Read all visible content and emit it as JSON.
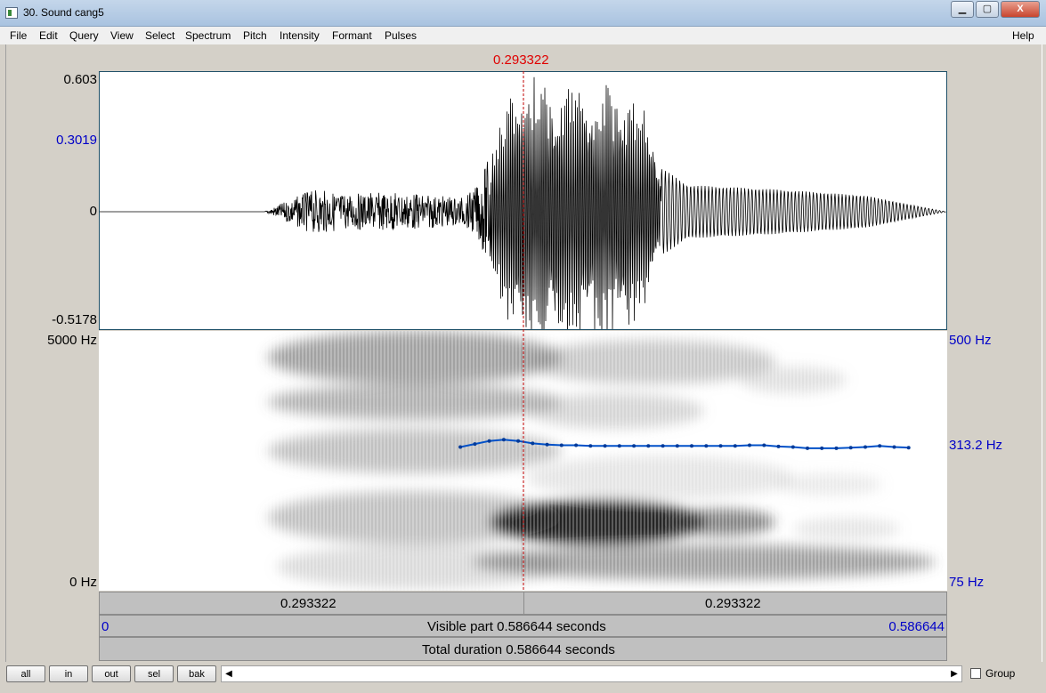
{
  "window": {
    "title": "30. Sound cang5",
    "minimize_label": "▁",
    "maximize_label": "▢",
    "close_label": "X"
  },
  "menu": {
    "items": [
      "File",
      "Edit",
      "Query",
      "View",
      "Select",
      "Spectrum",
      "Pitch",
      "Intensity",
      "Formant",
      "Pulses"
    ],
    "help": "Help"
  },
  "cursor": {
    "time_label": "0.293322",
    "color": "#e00000"
  },
  "waveform": {
    "ymax_label": "0.603",
    "mid_label": "0.3019",
    "zero_label": "0",
    "ymin_label": "-0.5178"
  },
  "spectrogram": {
    "freq_max_label": "5000 Hz",
    "freq_min_label": "0 Hz"
  },
  "pitch": {
    "max_label": "500 Hz",
    "value_label": "313.2 Hz",
    "min_label": "75 Hz",
    "color": "#0050c8"
  },
  "chart_data": {
    "type": "line",
    "title": "",
    "xlabel": "",
    "ylabel": "",
    "xlim": [
      0,
      0.586644
    ],
    "ylim": [
      75,
      500
    ],
    "x_unit": "s",
    "y_unit": "Hz",
    "series": [
      {
        "x": [
          0.25,
          0.26,
          0.27,
          0.28,
          0.29,
          0.3,
          0.31,
          0.32,
          0.33,
          0.34,
          0.35,
          0.36,
          0.37,
          0.38,
          0.39,
          0.4,
          0.41,
          0.42,
          0.43,
          0.44,
          0.45,
          0.46,
          0.47,
          0.48,
          0.49,
          0.5,
          0.51,
          0.52,
          0.53,
          0.54,
          0.55,
          0.56
        ],
        "values": [
          310,
          315,
          320,
          322,
          320,
          316,
          314,
          313,
          313,
          312,
          312,
          312,
          312,
          312,
          312,
          312,
          312,
          312,
          312,
          312,
          313,
          313,
          311,
          310,
          308,
          308,
          308,
          309,
          310,
          312,
          310,
          309
        ]
      }
    ]
  },
  "time_bars": {
    "left_segment_label": "0.293322",
    "right_segment_label": "0.293322",
    "visible_start": "0",
    "visible_label": "Visible part 0.586644 seconds",
    "visible_end": "0.586644",
    "total_label": "Total duration 0.586644 seconds"
  },
  "buttons": {
    "all": "all",
    "in": "in",
    "out": "out",
    "sel": "sel",
    "bak": "bak"
  },
  "scroll": {
    "left_arrow": "◀",
    "right_arrow": "▶"
  },
  "group": {
    "label": "Group",
    "checked": false
  }
}
